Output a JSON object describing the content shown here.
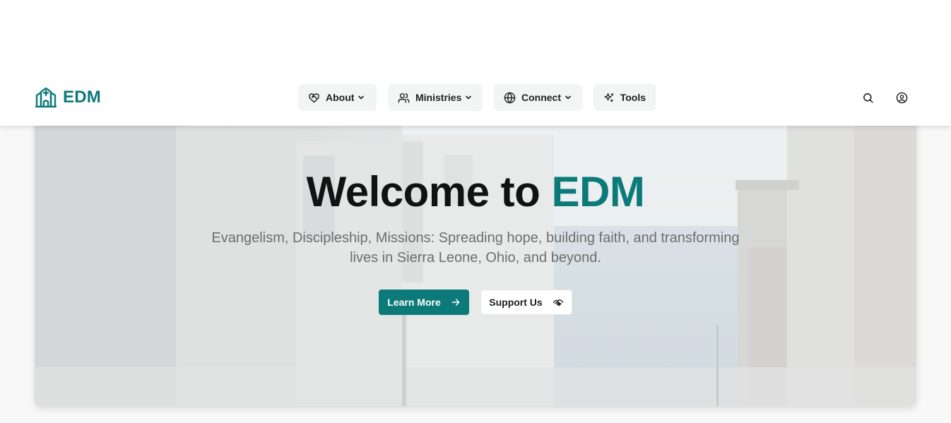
{
  "brand": {
    "name": "EDM",
    "icon": "church-icon",
    "color": "#0d7a7a"
  },
  "nav": {
    "items": [
      {
        "label": "About",
        "icon": "handshake-heart-icon",
        "dropdown": true
      },
      {
        "label": "Ministries",
        "icon": "users-icon",
        "dropdown": true
      },
      {
        "label": "Connect",
        "icon": "globe-icon",
        "dropdown": true
      },
      {
        "label": "Tools",
        "icon": "sparkles-icon",
        "dropdown": false
      }
    ],
    "actions": [
      {
        "icon": "search-icon"
      },
      {
        "icon": "user-circle-icon"
      }
    ]
  },
  "hero": {
    "title_prefix": "Welcome to ",
    "title_accent": "EDM",
    "subtitle": "Evangelism, Discipleship, Missions: Spreading hope, building faith, and transforming lives in Sierra Leone, Ohio, and beyond.",
    "primary_button": {
      "label": "Learn More",
      "icon": "arrow-right-icon"
    },
    "secondary_button": {
      "label": "Support Us",
      "icon": "handshake-icon"
    },
    "background_image": "whitewashed-alley-by-sea"
  },
  "colors": {
    "accent": "#0d7a7a",
    "text": "#121212",
    "muted": "#6d6d6d"
  }
}
